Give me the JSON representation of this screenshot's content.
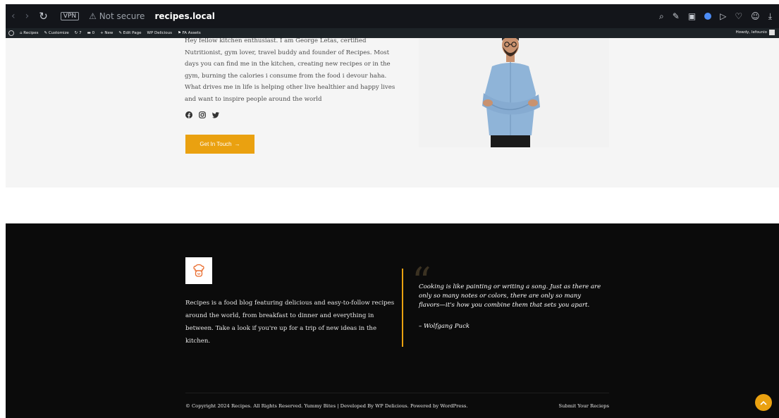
{
  "browser": {
    "vpn_label": "VPN",
    "security_label": "Not secure",
    "domain": "recipes.local"
  },
  "adminbar": {
    "site_name": "Recipes",
    "customize": "Customize",
    "updates_count": "7",
    "comments_count": "0",
    "new_label": "New",
    "edit_page": "Edit Page",
    "wp_delicious": "WP Delicious",
    "fa_assets": "FA Assets",
    "howdy": "Howdy, lefounio"
  },
  "about": {
    "text": "Hey fellow kitchen enthusiast. I am George Letas, certified Nutritionist, gym lover, travel buddy and founder of Recipes. Most days you can find me in the kitchen, creating new recipes or in the gym, burning the calories i consume from the food i devour haha. What drives me in life is helping other live healthier and happy lives and want to inspire people around the world",
    "cta_label": "Get In Touch",
    "cta_arrow": "→"
  },
  "footer": {
    "description": "Recipes is a food blog featuring delicious and easy-to-follow recipes around the world, from breakfast to dinner and everything in between. Take a look if you're up for a trip of new ideas in the kitchen.",
    "quote_mark": "“",
    "quote": "Cooking is like painting or writing a song. Just as there are only so many notes or colors, there are only so many flavors—it's how you combine them that sets you apart.",
    "quote_author": "– Wolfgang Puck",
    "copyright": "© Copyright 2024 Recipes. All Rights Reserved. Yummy Bites | Developed By WP Delicious. Powered by WordPress.",
    "submit_link": "Submit Your Recieps"
  },
  "colors": {
    "accent": "#eaa110",
    "footer_bg": "#0b0b0b",
    "about_bg": "#f5f5f5"
  }
}
